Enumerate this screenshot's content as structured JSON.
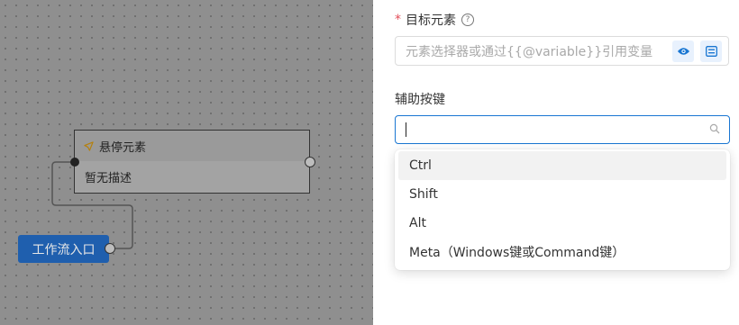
{
  "canvas": {
    "node": {
      "title": "悬停元素",
      "description": "暂无描述"
    },
    "start_label": "工作流入口"
  },
  "panel": {
    "target_label": "目标元素",
    "target_required_mark": "*",
    "target_placeholder": "元素选择器或通过{{@variable}}引用变量",
    "modifier_label": "辅助按键",
    "options": [
      "Ctrl",
      "Shift",
      "Alt",
      "Meta（Windows键或Command键）"
    ],
    "highlighted_option": "Ctrl"
  },
  "colors": {
    "accent": "#1976d2",
    "start_button": "#1f5fae",
    "required": "#e34d59"
  },
  "icons": [
    "pointer-icon",
    "help-icon",
    "eye-icon",
    "variable-icon",
    "search-icon"
  ]
}
